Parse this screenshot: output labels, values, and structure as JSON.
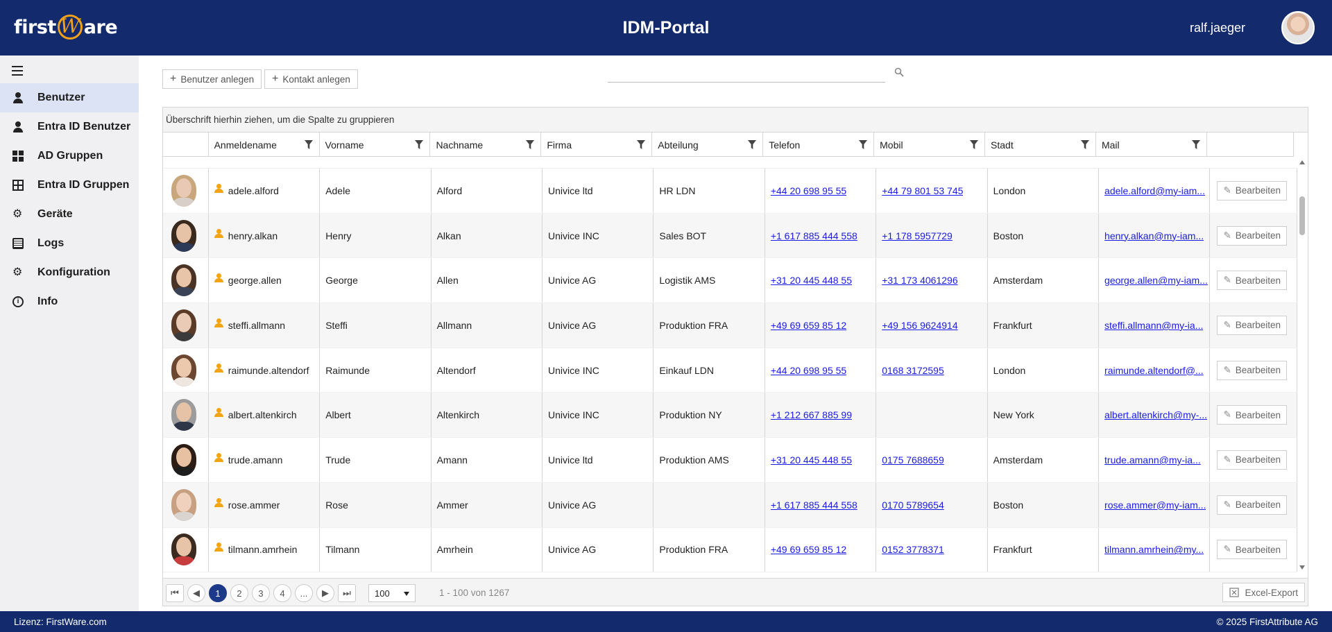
{
  "header": {
    "logo_left": "first",
    "logo_w": "W",
    "logo_right": "are",
    "title": "IDM-Portal",
    "user": "ralf.jaeger"
  },
  "sidebar": {
    "items": [
      {
        "label": "Benutzer",
        "icon": "person-icon",
        "active": true
      },
      {
        "label": "Entra ID Benutzer",
        "icon": "person-icon"
      },
      {
        "label": "AD Gruppen",
        "icon": "grid-icon"
      },
      {
        "label": "Entra ID Gruppen",
        "icon": "group-grid-icon"
      },
      {
        "label": "Geräte",
        "icon": "gears-icon"
      },
      {
        "label": "Logs",
        "icon": "clipboard-icon"
      },
      {
        "label": "Konfiguration",
        "icon": "gear-icon"
      },
      {
        "label": "Info",
        "icon": "info-icon"
      }
    ]
  },
  "toolbar": {
    "add_user": "Benutzer anlegen",
    "add_contact": "Kontakt anlegen",
    "search_value": "",
    "search_placeholder": ""
  },
  "grid": {
    "group_hint": "Überschrift hierhin ziehen, um die Spalte zu gruppieren",
    "columns": [
      "Anmeldename",
      "Vorname",
      "Nachname",
      "Firma",
      "Abteilung",
      "Telefon",
      "Mobil",
      "Stadt",
      "Mail"
    ],
    "edit_label": "Bearbeiten",
    "rows": [
      {
        "login": "adele.alford",
        "first": "Adele",
        "last": "Alford",
        "company": "Univice ltd",
        "dept": "HR LDN",
        "phone": "+44 20 698 95 55",
        "mobile": "+44 79 801 53 745",
        "city": "London",
        "mail": "adele.alford@my-iam...",
        "skin": "#e9c9b3",
        "hair": "#c9a77c",
        "shirt": "#d8d0c8"
      },
      {
        "login": "henry.alkan",
        "first": "Henry",
        "last": "Alkan",
        "company": "Univice INC",
        "dept": "Sales BOT",
        "phone": "+1 617 885 444 558",
        "mobile": "+1 178 5957729",
        "city": "Boston",
        "mail": "henry.alkan@my-iam...",
        "skin": "#e6c2a6",
        "hair": "#3a2a1e",
        "shirt": "#2d3a57"
      },
      {
        "login": "george.allen",
        "first": "George",
        "last": "Allen",
        "company": "Univice AG",
        "dept": "Logistik AMS",
        "phone": "+31 20 445 448 55",
        "mobile": "+31 173 4061296",
        "city": "Amsterdam",
        "mail": "george.allen@my-iam...",
        "skin": "#e8c4a9",
        "hair": "#4a3325",
        "shirt": "#3a4256"
      },
      {
        "login": "steffi.allmann",
        "first": "Steffi",
        "last": "Allmann",
        "company": "Univice AG",
        "dept": "Produktion FRA",
        "phone": "+49 69 659 85 12",
        "mobile": "+49 156 9624914",
        "city": "Frankfurt",
        "mail": "steffi.allmann@my-ia...",
        "skin": "#eacbb5",
        "hair": "#5a3b28",
        "shirt": "#3b3b3b"
      },
      {
        "login": "raimunde.altendorf",
        "first": "Raimunde",
        "last": "Altendorf",
        "company": "Univice INC",
        "dept": "Einkauf LDN",
        "phone": "+44 20 698 95 55",
        "mobile": "0168 3172595",
        "city": "London",
        "mail": "raimunde.altendorf@...",
        "skin": "#ecc8ad",
        "hair": "#6b4630",
        "shirt": "#efe7df"
      },
      {
        "login": "albert.altenkirch",
        "first": "Albert",
        "last": "Altenkirch",
        "company": "Univice INC",
        "dept": "Produktion NY",
        "phone": "+1 212 667 885 99",
        "mobile": "",
        "city": "New York",
        "mail": "albert.altenkirch@my-...",
        "skin": "#e6c3a7",
        "hair": "#9c9c9c",
        "shirt": "#2f3648"
      },
      {
        "login": "trude.amann",
        "first": "Trude",
        "last": "Amann",
        "company": "Univice ltd",
        "dept": "Produktion AMS",
        "phone": "+31 20 445 448 55",
        "mobile": "0175 7688659",
        "city": "Amsterdam",
        "mail": "trude.amann@my-ia...",
        "skin": "#e8c0a2",
        "hair": "#2b1c14",
        "shirt": "#1d1d1d"
      },
      {
        "login": "rose.ammer",
        "first": "Rose",
        "last": "Ammer",
        "company": "Univice AG",
        "dept": "",
        "phone": "+1 617 885 444 558",
        "mobile": "0170 5789654",
        "city": "Boston",
        "mail": "rose.ammer@my-iam...",
        "skin": "#f0d1bd",
        "hair": "#c6a080",
        "shirt": "#d9d4d0"
      },
      {
        "login": "tilmann.amrhein",
        "first": "Tilmann",
        "last": "Amrhein",
        "company": "Univice AG",
        "dept": "Produktion FRA",
        "phone": "+49 69 659 85 12",
        "mobile": "0152 3778371",
        "city": "Frankfurt",
        "mail": "tilmann.amrhein@my...",
        "skin": "#e7c4a8",
        "hair": "#3b2a20",
        "shirt": "#c73c3c"
      }
    ]
  },
  "pager": {
    "pages": [
      "1",
      "2",
      "3",
      "4",
      "..."
    ],
    "current": "1",
    "page_size": "100",
    "info": "1 - 100 von 1267",
    "excel": "Excel-Export"
  },
  "footer": {
    "license": "Lizenz: FirstWare.com",
    "copyright": "© 2025 FirstAttribute AG"
  }
}
